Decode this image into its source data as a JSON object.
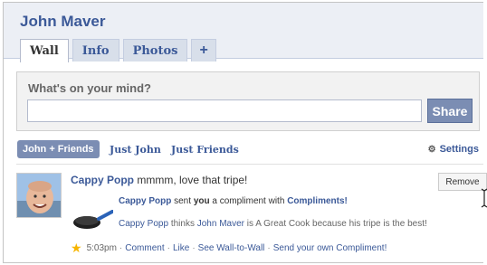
{
  "profile": {
    "name": "John Maver"
  },
  "tabs": [
    {
      "label": "Wall",
      "active": true
    },
    {
      "label": "Info"
    },
    {
      "label": "Photos"
    },
    {
      "label": "+"
    }
  ],
  "composer": {
    "prompt": "What's on your mind?",
    "input_value": "",
    "share_label": "Share"
  },
  "filters": {
    "items": [
      {
        "label": "John + Friends",
        "active": true
      },
      {
        "label": "Just John"
      },
      {
        "label": "Just Friends"
      }
    ],
    "settings_label": "Settings",
    "settings_icon": "gear-icon"
  },
  "story": {
    "poster": "Cappy Popp",
    "message": "mmmm, love that tripe!",
    "remove_label": "Remove",
    "compliment_line": {
      "sender": "Cappy Popp",
      "t1": " sent ",
      "you": "you",
      "t2": " a compliment with ",
      "app": "Compliments!"
    },
    "detail_line": {
      "sender": "Cappy Popp",
      "t1": " thinks ",
      "target": "John Maver",
      "t2": " is A Great Cook because his tripe is the best!"
    },
    "meta": {
      "star_icon": "star-icon",
      "time": "5:03pm",
      "comment": "Comment",
      "like": "Like",
      "wall_to_wall": "See Wall-to-Wall",
      "send": "Send your own Compliment!"
    }
  },
  "colors": {
    "brand": "#3b5998",
    "button": "#7b8db3",
    "header_bg": "#eceff5"
  }
}
